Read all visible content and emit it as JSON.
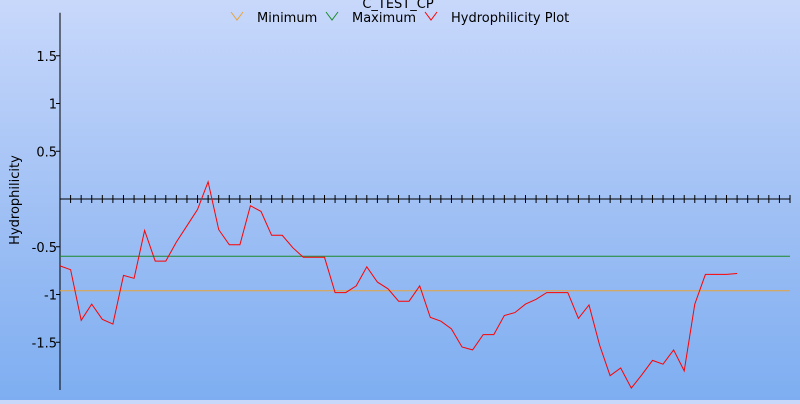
{
  "chart_data": {
    "type": "line",
    "title": "C_TEST_CP",
    "xlabel": "",
    "ylabel": "Hydrophilicity",
    "ylim": [
      -2.0,
      1.95
    ],
    "yticks": [
      1.5,
      1,
      0.5,
      -0.5,
      -1,
      -1.5
    ],
    "ytick_labels": [
      "1.5",
      "1",
      "0.5",
      "-0.5",
      "-1",
      "-1.5"
    ],
    "grid": false,
    "legend_position": "top",
    "x_count": 70,
    "series": [
      {
        "name": "Minimum",
        "color": "#e8a33a",
        "values": [
          -0.96,
          -0.96
        ]
      },
      {
        "name": "Maximum",
        "color": "#1a8a2a",
        "values": [
          -0.6,
          -0.6
        ]
      },
      {
        "name": "Hydrophilicity Plot",
        "color": "#ff0000",
        "values": [
          -0.7,
          -0.74,
          -1.27,
          -1.1,
          -1.26,
          -1.31,
          -0.8,
          -0.83,
          -0.33,
          -0.65,
          -0.65,
          -0.45,
          -0.28,
          -0.11,
          0.18,
          -0.32,
          -0.48,
          -0.48,
          -0.07,
          -0.13,
          -0.38,
          -0.38,
          -0.51,
          -0.61,
          -0.61,
          -0.61,
          -0.98,
          -0.98,
          -0.91,
          -0.71,
          -0.87,
          -0.94,
          -1.07,
          -1.07,
          -0.91,
          -1.24,
          -1.28,
          -1.36,
          -1.55,
          -1.58,
          -1.42,
          -1.42,
          -1.22,
          -1.19,
          -1.1,
          -1.05,
          -0.98,
          -0.98,
          -0.98,
          -1.25,
          -1.11,
          -1.53,
          -1.85,
          -1.77,
          -1.98,
          -1.84,
          -1.69,
          -1.73,
          -1.58,
          -1.8,
          -1.1,
          -0.79,
          -0.79,
          -0.79,
          -0.78
        ]
      }
    ]
  }
}
